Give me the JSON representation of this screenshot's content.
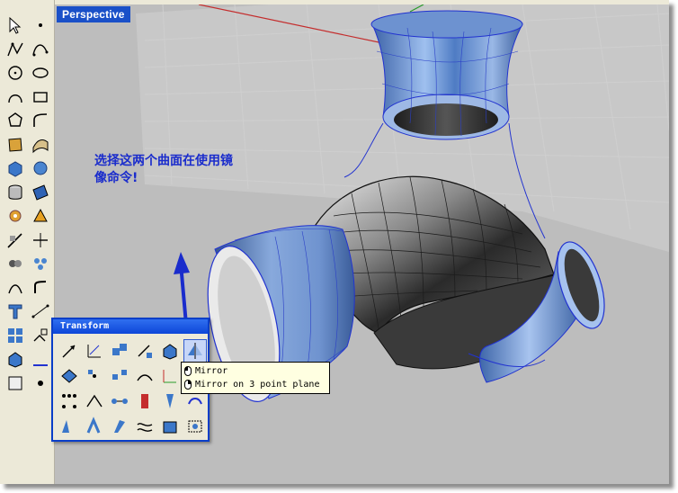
{
  "viewport": {
    "title": "Perspective"
  },
  "annotation": {
    "line1": "选择这两个曲面在使用镜",
    "line2": "像命令!"
  },
  "transform_panel": {
    "title": "Transform"
  },
  "tooltip": {
    "items": [
      "Mirror",
      "Mirror on 3 point plane"
    ]
  },
  "colors": {
    "viewport_bg": "#bdbdbd",
    "title_bg": "#1a50c8",
    "annotation_text": "#1a2ccc",
    "panel_border": "#0a3ec8",
    "tooltip_bg": "#ffffe1",
    "surface_blue": "#5f8fd6",
    "surface_dark": "#2a2a2a",
    "edge_blue": "#2233d0"
  },
  "left_toolbar": {
    "icons": [
      "pointer-arrow-icon",
      "point-icon",
      "polyline-icon",
      "curve-point-icon",
      "circle-icon",
      "ellipse-icon",
      "arc-icon",
      "rectangle-icon",
      "polygon-icon",
      "fillet-curve-icon",
      "surface-corner-icon",
      "surface-loft-icon",
      "box-solid-icon",
      "sphere-icon",
      "cylinder-icon",
      "surface-patch-icon",
      "boolean-gear-icon",
      "split-surface-icon",
      "trim-icon",
      "explode-icon",
      "join-icon",
      "group-icon",
      "offset-icon",
      "fillet-edge-icon",
      "text-icon",
      "dimension-icon",
      "array-icon",
      "transform-icon",
      "mesh-icon",
      "render-icon",
      "layer-icon",
      "snap-icon"
    ]
  },
  "panel_tools": [
    "move-icon",
    "scale-icon",
    "copy-icon",
    "rotate-icon",
    "box-3d-icon",
    "mirror-icon",
    "align-icon",
    "array-polar-icon",
    "orient-icon",
    "bend-icon",
    "mirror-plane-icon",
    "twist-icon",
    "array-grid-icon",
    "flow-icon",
    "taper-icon",
    "stretch-icon",
    "shear-icon",
    "smooth-icon",
    "flow-along-icon",
    "project-icon",
    "splop-icon",
    "wave-icon",
    "cage-icon",
    "deform-icon"
  ]
}
